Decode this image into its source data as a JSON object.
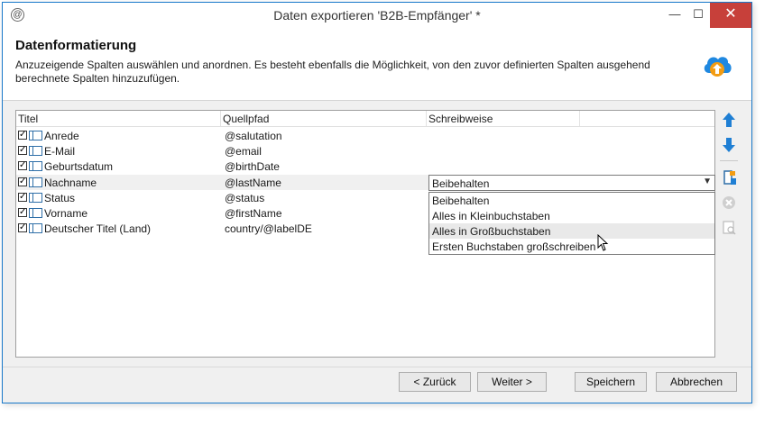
{
  "window": {
    "title": "Daten exportieren 'B2B-Empfänger' *",
    "minimize": "—",
    "maximize": "☐",
    "close": "✕"
  },
  "header": {
    "heading": "Datenformatierung",
    "description": "Anzuzeigende Spalten auswählen und anordnen. Es besteht ebenfalls die Möglichkeit, von den zuvor definierten Spalten ausgehend berechnete Spalten hinzuzufügen."
  },
  "grid": {
    "columns": [
      "Titel",
      "Quellpfad",
      "Schreibweise"
    ],
    "rows": [
      {
        "title": "Anrede",
        "path": "@salutation",
        "checked": true
      },
      {
        "title": "E-Mail",
        "path": "@email",
        "checked": true
      },
      {
        "title": "Geburtsdatum",
        "path": "@birthDate",
        "checked": true
      },
      {
        "title": "Nachname",
        "path": "@lastName",
        "checked": true
      },
      {
        "title": "Status",
        "path": "@status",
        "checked": true
      },
      {
        "title": "Vorname",
        "path": "@firstName",
        "checked": true
      },
      {
        "title": "Deutscher Titel (Land)",
        "path": "country/@labelDE",
        "checked": true
      }
    ],
    "selected_row": 3
  },
  "case_select": {
    "value": "Beibehalten",
    "options": [
      "Beibehalten",
      "Alles in Kleinbuchstaben",
      "Alles in Großbuchstaben",
      "Ersten Buchstaben großschreiben"
    ],
    "hovered_option": 2
  },
  "side_tools": [
    "arrow-up-icon",
    "arrow-down-icon",
    "add-computed-column-icon",
    "delete-icon",
    "detail-icon"
  ],
  "footer": {
    "back": "< Zurück",
    "next": "Weiter >",
    "save": "Speichern",
    "cancel": "Abbrechen"
  },
  "colors": {
    "accent": "#1f7fd4",
    "close": "#c7403a"
  }
}
